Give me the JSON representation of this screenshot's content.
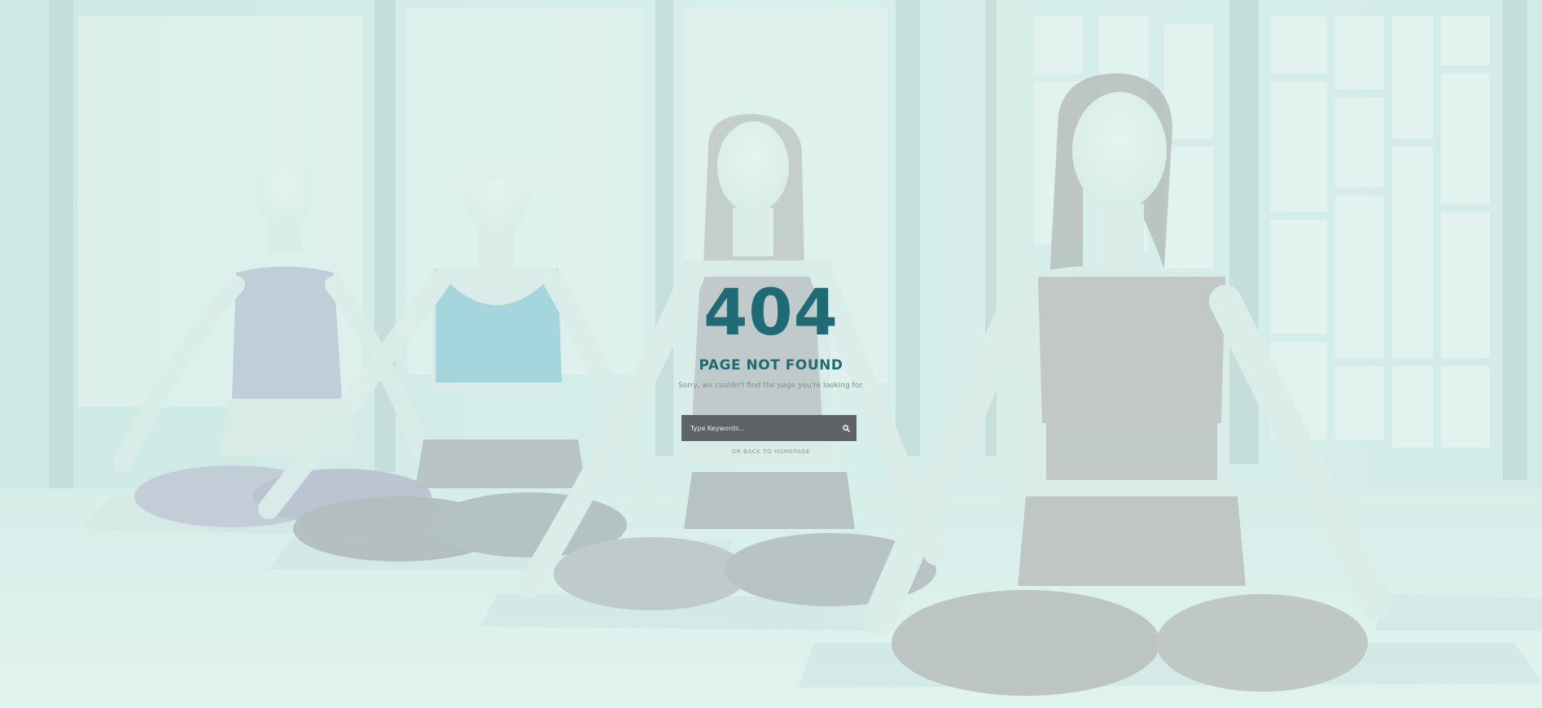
{
  "error": {
    "code": "404",
    "title": "PAGE NOT FOUND",
    "message": "Sorry, we couldn't find the page you're looking for."
  },
  "search": {
    "placeholder": "Type Keywords..."
  },
  "back_link": {
    "label": "OR BACK TO HOMEPAGE"
  },
  "colors": {
    "accent": "#1f6b75",
    "search_bg": "#606366",
    "overlay": "#d6f2ec"
  },
  "icons": {
    "search_button": "search-icon"
  }
}
